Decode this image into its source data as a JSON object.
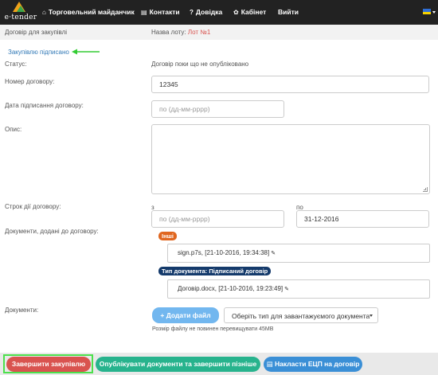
{
  "navbar": {
    "logo_text": "e·tender",
    "items": [
      {
        "label": "Торговельний майданчик",
        "icon": "home-icon",
        "glyph": "⌂"
      },
      {
        "label": "Контакти",
        "icon": "contacts-icon",
        "glyph": "▤"
      },
      {
        "label": "Довідка",
        "icon": "help-icon",
        "glyph": "?"
      },
      {
        "label": "Кабінет",
        "icon": "paw-icon",
        "glyph": "✿"
      },
      {
        "label": "Вийти",
        "icon": "",
        "glyph": ""
      }
    ],
    "flag": "ukraine-flag"
  },
  "subheader": {
    "contract_label": "Договір для закупівлі",
    "lot_label": "Назва лоту:",
    "lot_value": "Лот №1"
  },
  "status_link": "Закупівлю підписано",
  "form": {
    "status_label": "Статус:",
    "status_value": "Договір поки що не опубліковано",
    "contract_number_label": "Номер договору:",
    "contract_number_value": "12345",
    "sign_date_label": "Дата підписання договору:",
    "sign_date_placeholder": "по (дд-мм-рррр)",
    "description_label": "Опис:",
    "description_value": "",
    "term_label": "Строк дії договору:",
    "term_from_label": "з",
    "term_from_placeholder": "по (дд-мм-рррр)",
    "term_to_label": "по",
    "term_to_value": "31-12-2016",
    "docs_added_label": "Документи, додані до договору:",
    "doc_groups": [
      {
        "badge": "Інші",
        "file": "sign.p7s, [21-10-2016, 19:34:38]"
      },
      {
        "badge": "Тип документа: Підписаний договір",
        "file": "Договір.docx, [21-10-2016, 19:23:49]"
      }
    ],
    "documents_label": "Документи:",
    "add_file_button": "+ Додати файл",
    "doc_type_select": "Оберіть тип для завантажуємого документа",
    "file_size_note": "Розмір файлу не повинен перевищувати 45MB"
  },
  "footer": {
    "finish_button": "Завершити закупівлю",
    "publish_button": "Опублікувати документи та завершити пізніше",
    "sign_button": "Накласти ЕЦП на договір"
  },
  "colors": {
    "navbar": "#222222",
    "orange_badge": "#e0661f",
    "navy_badge": "#143a6b",
    "add_button": "#72b7ef",
    "finish_button": "#d9534f",
    "publish_button": "#27b38d",
    "sign_button": "#3a8fd6",
    "highlight": "#4ce04c",
    "arrow": "#33cc33"
  }
}
